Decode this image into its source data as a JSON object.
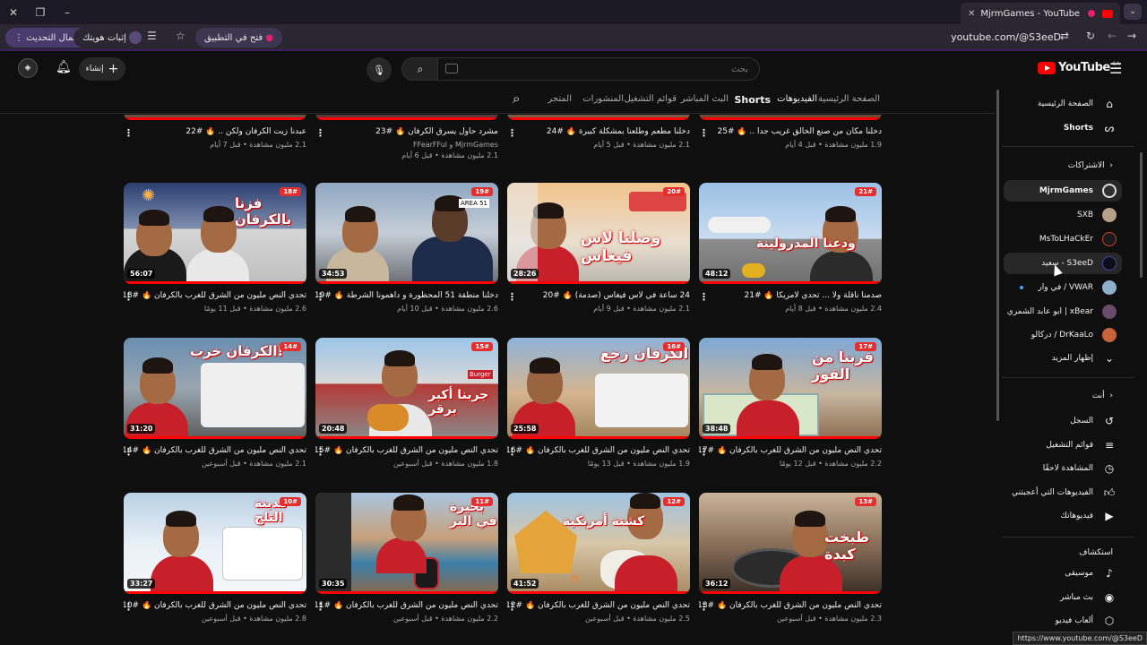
{
  "browser": {
    "tab_title": "MjrmGames - YouTube",
    "url": "youtube.com/@S3eeD",
    "update_button": "إكمال التحديث",
    "verify_button": "إثبات هويتك",
    "open_in_app": "فتح في التطبيق",
    "status_url": "https://www.youtube.com/@S3eeD"
  },
  "header": {
    "create_label": "إنشاء",
    "search_placeholder": "بحث",
    "logo_text": "YouTube",
    "logo_country": "SA"
  },
  "channel_tabs": [
    "الصفحة الرئيسية",
    "الفيديوهات",
    "Shorts",
    "البث المباشر",
    "قوائم التشغيل",
    "المنشورات",
    "المتجر"
  ],
  "videos_top": [
    {
      "title": "دخلنا مكان من صنع الخالق غريب جدا .. 🔥 #25",
      "meta": "1.9 مليون مشاهدة • قبل 4 أيام",
      "channel": ""
    },
    {
      "title": "دخلنا مطعم وطلعنا بمشكلة كبيرة 🔥 #24",
      "meta": "2.1 مليون مشاهدة • قبل 5 أيام",
      "channel": ""
    },
    {
      "title": "مشرد حاول يسرق الكرفان 🔥 #23",
      "meta": "2.1 مليون مشاهدة • قبل 6 أيام",
      "channel": "MjrmGames و FFearFFul"
    },
    {
      "title": "عبدنا زيت الكرفان ولكن .. 🔥 #22",
      "meta": "2.1 مليون مشاهدة • قبل 7 أيام",
      "channel": ""
    }
  ],
  "videos_row1": [
    {
      "title": "صدمنا ناقلة ولا ... تحدي لامريكا 🔥 #21",
      "meta": "2.4 مليون مشاهدة • قبل 8 أيام",
      "duration": "48:12",
      "badge": "21#",
      "overlay": "ودعنا المدرولينة"
    },
    {
      "title": "24 ساعة في لاس فيغاس (صدمة) 🔥 #20",
      "meta": "2.1 مليون مشاهدة • قبل 9 أيام",
      "duration": "28:26",
      "badge": "20#",
      "overlay": "وصلنا لاس فيغاس"
    },
    {
      "title": "دخلنا منطقة 51 المحظورة و داهمونا الشرطة 🔥 #19",
      "meta": "2.6 مليون مشاهدة • قبل 10 أيام",
      "duration": "34:53",
      "badge": "19#",
      "overlay": ""
    },
    {
      "title": "تحدي النص مليون من الشرق للغرب بالكرفان 🔥 #18",
      "meta": "2.6 مليون مشاهدة • قبل 11 يومًا",
      "duration": "56:07",
      "badge": "18#",
      "overlay": "فزنا بالكرفان"
    }
  ],
  "videos_row2": [
    {
      "title": "تحدي النص مليون من الشرق للغرب بالكرفان 🔥 #17",
      "meta": "2.2 مليون مشاهدة • قبل 12 يومًا",
      "duration": "38:48",
      "badge": "17#",
      "overlay": "قربنا من الفوز"
    },
    {
      "title": "تحدي النص مليون من الشرق للغرب بالكرفان 🔥 #16",
      "meta": "1.9 مليون مشاهدة • قبل 13 يومًا",
      "duration": "25:58",
      "badge": "16#",
      "overlay": "الكرفان رجع"
    },
    {
      "title": "تحدي النص مليون من الشرق للغرب بالكرفان 🔥 #15",
      "meta": "1.8 مليون مشاهدة • قبل أسبوعين",
      "duration": "20:48",
      "badge": "15#",
      "overlay": "جربنا أكبر برقر"
    },
    {
      "title": "تحدي النص مليون من الشرق للغرب بالكرفان 🔥 #14",
      "meta": "2.1 مليون مشاهدة • قبل أسبوعين",
      "duration": "31:20",
      "badge": "14#",
      "overlay": "الكرفان خرب!"
    }
  ],
  "videos_row3": [
    {
      "title": "تحدي النص مليون من الشرق للغرب بالكرفان 🔥 #13",
      "meta": "2.3 مليون مشاهدة • قبل أسبوعين",
      "duration": "36:12",
      "badge": "13#",
      "overlay": "طبخت كبدة"
    },
    {
      "title": "تحدي النص مليون من الشرق للغرب بالكرفان 🔥 #12",
      "meta": "2.5 مليون مشاهدة • قبل أسبوعين",
      "duration": "41:52",
      "badge": "12#",
      "overlay": "كشتة أمريكية"
    },
    {
      "title": "تحدي النص مليون من الشرق للغرب بالكرفان 🔥 #11",
      "meta": "2.2 مليون مشاهدة • قبل أسبوعين",
      "duration": "30:35",
      "badge": "11#",
      "overlay": "بحيرة في البر"
    },
    {
      "title": "تحدي النص مليون من الشرق للغرب بالكرفان 🔥 #10",
      "meta": "2.8 مليون مشاهدة • قبل أسبوعين",
      "duration": "33:27",
      "badge": "10#",
      "overlay": "مدينة الثلج"
    }
  ],
  "sidebar": {
    "home": "الصفحة الرئيسية",
    "shorts": "Shorts",
    "subs_header": "الاشتراكات",
    "subs": [
      "MjrmGames",
      "SXB",
      "MsToLHaCkEr",
      "سعيد - S3eeD",
      "في وار / VWAR",
      "ابو عابد الشمري | xBear",
      "دركالو / DrKaaLo"
    ],
    "show_more": "إظهار المزيد",
    "you_header": "أنت",
    "you_items": [
      "السجل",
      "قوائم التشغيل",
      "المشاهدة لاحقًا",
      "الفيديوهات التي أعجبتني",
      "فيديوهاتك"
    ],
    "explore_header": "استكشاف",
    "explore_items": [
      "موسيقى",
      "بث مباشر",
      "ألعاب فيديو"
    ]
  }
}
